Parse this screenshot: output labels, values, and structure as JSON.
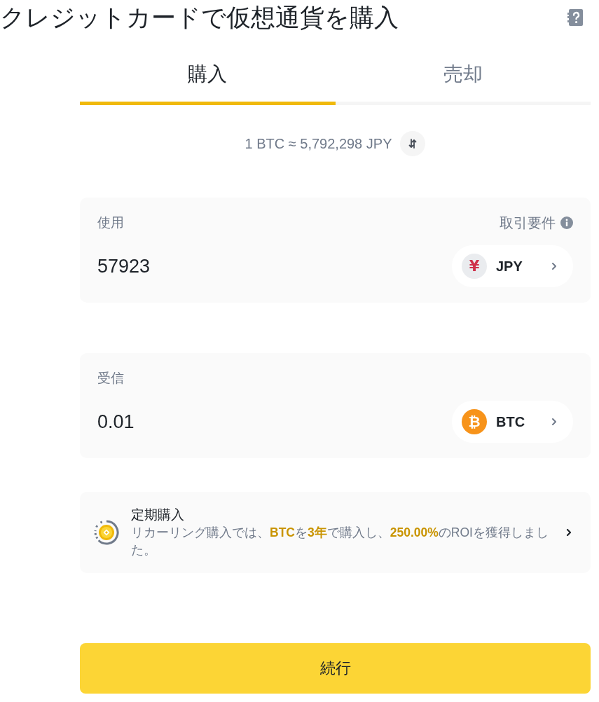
{
  "header": {
    "title": "クレジットカードで仮想通貨を購入"
  },
  "tabs": [
    {
      "label": "購入",
      "selected": true
    },
    {
      "label": "売却",
      "selected": false
    }
  ],
  "rate": {
    "text": "1 BTC ≈ 5,792,298 JPY"
  },
  "fields": [
    {
      "label": "使用",
      "link": "取引要件",
      "value": "57923",
      "currency": {
        "kind": "fiat",
        "symbol": "¥",
        "code": "JPY"
      }
    },
    {
      "label": "受信",
      "value": "0.01",
      "currency": {
        "kind": "crypto",
        "symbol": "₿",
        "code": "BTC"
      }
    }
  ],
  "recurring": {
    "title": "定期購入",
    "description": "リカーリング購入では、**BTC**を**3年**で購入し、**250.00%**のROIを獲得しました。"
  },
  "buttons": [
    {
      "label": "続行"
    }
  ]
}
